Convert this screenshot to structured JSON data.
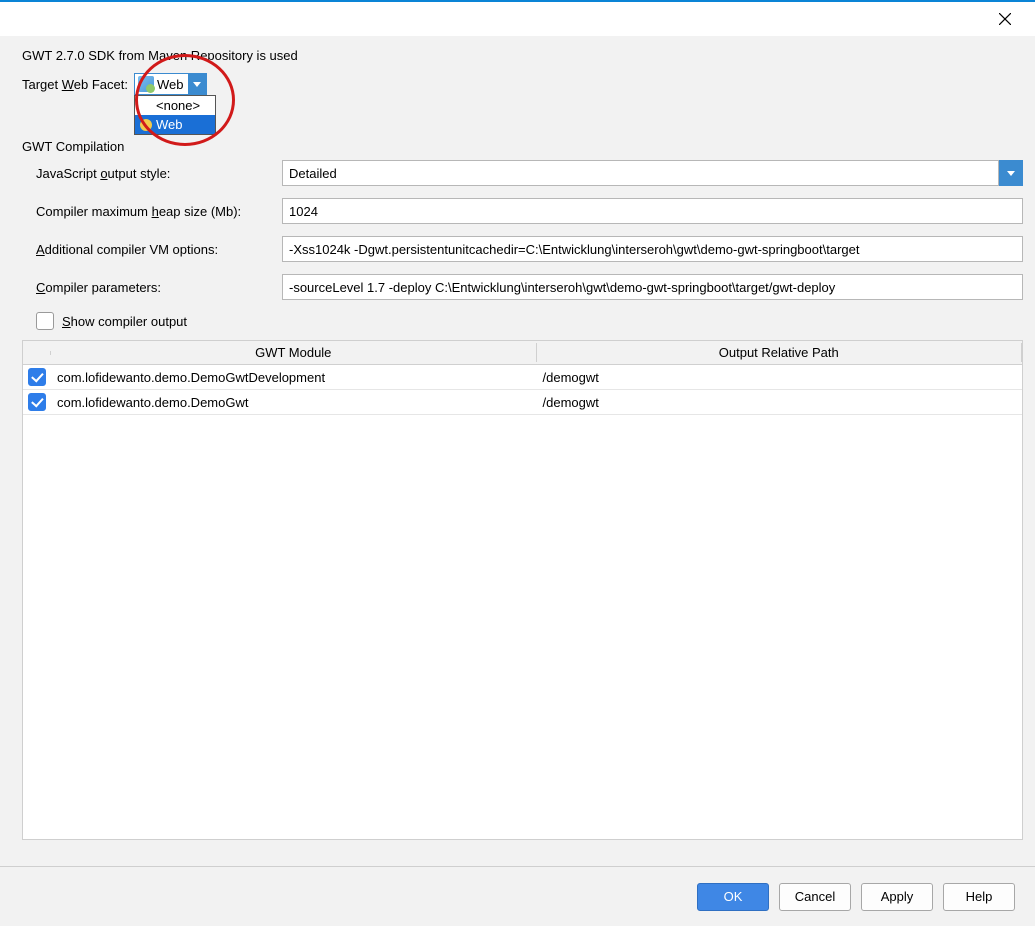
{
  "header": {
    "sdk_line": "GWT 2.7.0 SDK from Maven Repository is used",
    "target_label_pre": "Target ",
    "target_label_u": "W",
    "target_label_post": "eb Facet:",
    "combo_value": "Web",
    "dropdown": {
      "opt_none": "<none>",
      "opt_web": "Web"
    }
  },
  "section": {
    "title": "GWT Compilation"
  },
  "fields": {
    "js_style": {
      "label_pre": "JavaScript ",
      "label_u": "o",
      "label_post": "utput style:",
      "value": "Detailed"
    },
    "heap": {
      "label_pre": "Compiler maximum ",
      "label_u": "h",
      "label_post": "eap size (Mb):",
      "value": "1024"
    },
    "vmopts": {
      "label_u": "A",
      "label_post": "dditional compiler VM options:",
      "value": "-Xss1024k -Dgwt.persistentunitcachedir=C:\\Entwicklung\\interseroh\\gwt\\demo-gwt-springboot\\target"
    },
    "params": {
      "label_u": "C",
      "label_post": "ompiler parameters:",
      "value": "-sourceLevel 1.7 -deploy C:\\Entwicklung\\interseroh\\gwt\\demo-gwt-springboot\\target/gwt-deploy"
    },
    "show_output": {
      "label_u": "S",
      "label_post": "how compiler output",
      "checked": false
    }
  },
  "table": {
    "col_module": "GWT Module",
    "col_path": "Output Relative Path",
    "rows": [
      {
        "checked": true,
        "module": "com.lofidewanto.demo.DemoGwtDevelopment",
        "path": "/demogwt"
      },
      {
        "checked": true,
        "module": "com.lofidewanto.demo.DemoGwt",
        "path": "/demogwt"
      }
    ]
  },
  "buttons": {
    "ok": "OK",
    "cancel": "Cancel",
    "apply": "Apply",
    "help": "Help"
  }
}
